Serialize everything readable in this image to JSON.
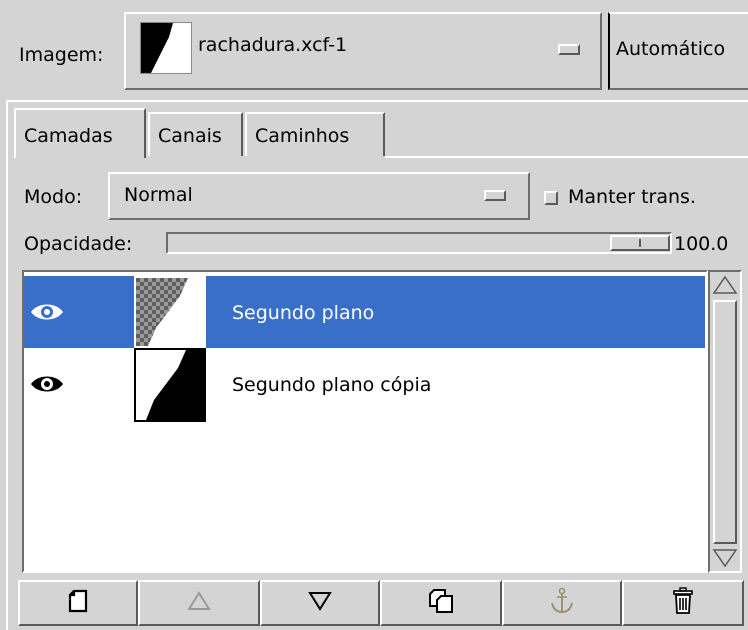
{
  "image_selector": {
    "label": "Imagem:",
    "current": "rachadura.xcf-1",
    "auto_button": "Automático"
  },
  "tabs": [
    {
      "label": "Camadas",
      "active": true
    },
    {
      "label": "Canais",
      "active": false
    },
    {
      "label": "Caminhos",
      "active": false
    }
  ],
  "mode": {
    "label": "Modo:",
    "value": "Normal"
  },
  "keep_trans": {
    "label": "Manter trans.",
    "checked": false
  },
  "opacity": {
    "label": "Opacidade:",
    "value": "100.0",
    "fraction": 1.0
  },
  "layers": [
    {
      "name": "Segundo plano",
      "visible": true,
      "selected": true
    },
    {
      "name": "Segundo plano cópia",
      "visible": true,
      "selected": false
    }
  ],
  "toolbar": [
    {
      "icon": "new-layer-icon",
      "enabled": true
    },
    {
      "icon": "raise-layer-icon",
      "enabled": false
    },
    {
      "icon": "lower-layer-icon",
      "enabled": true
    },
    {
      "icon": "duplicate-layer-icon",
      "enabled": true
    },
    {
      "icon": "anchor-layer-icon",
      "enabled": false
    },
    {
      "icon": "delete-layer-icon",
      "enabled": true
    }
  ],
  "colors": {
    "selection": "#3a6fc9",
    "background": "#d4d4d4",
    "list_background": "#ffffff"
  }
}
